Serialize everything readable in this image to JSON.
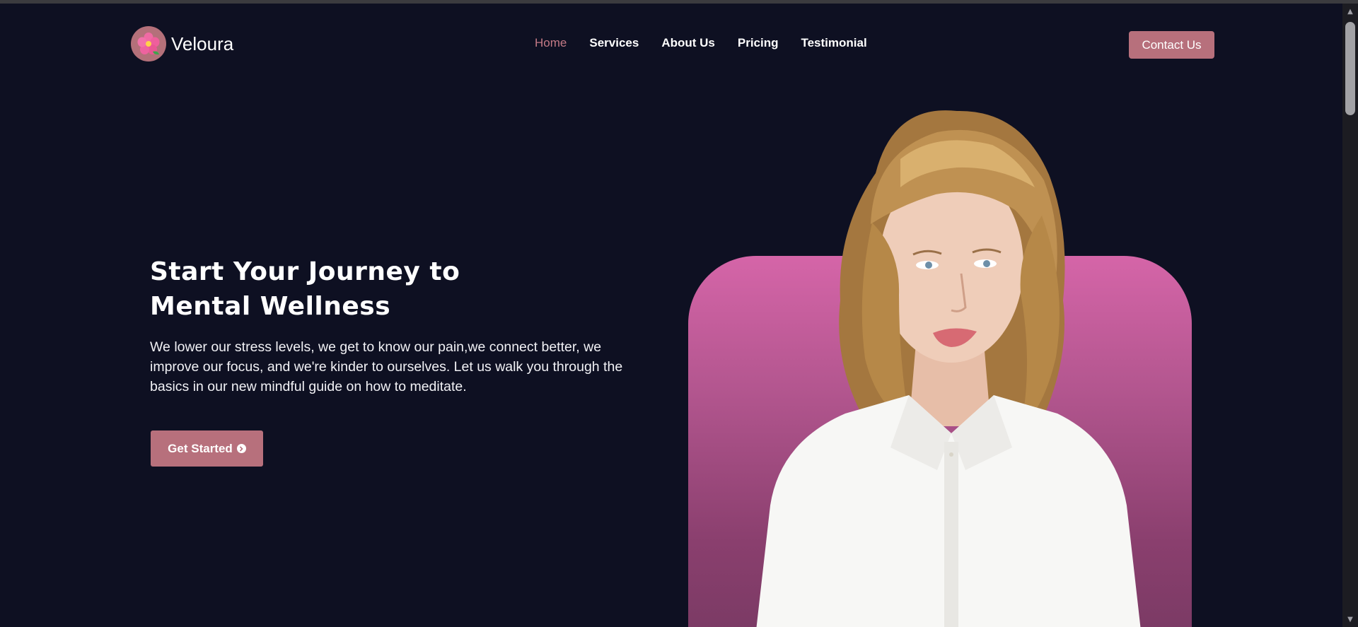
{
  "brand": {
    "name": "Veloura",
    "logo_icon": "hibiscus-flower-icon"
  },
  "nav": {
    "links": [
      {
        "label": "Home",
        "active": true
      },
      {
        "label": "Services",
        "active": false
      },
      {
        "label": "About Us",
        "active": false
      },
      {
        "label": "Pricing",
        "active": false
      },
      {
        "label": "Testimonial",
        "active": false
      }
    ],
    "contact_label": "Contact Us"
  },
  "hero": {
    "title_line1": "Start Your Journey to",
    "title_line2": "Mental Wellness",
    "description": "We lower our stress levels, we get to know our pain,we connect better, we improve our focus, and we're kinder to ourselves. Let us walk you through the basics in our new mindful guide on how to meditate.",
    "cta_label": "Get Started",
    "cta_icon": "arrow-circle-right-icon",
    "image_alt": "portrait of woman in white shirt"
  },
  "colors": {
    "background": "#0e1022",
    "accent": "#b7707c",
    "active_link": "#c47a86",
    "image_gradient_top": "#d565a8",
    "image_gradient_bottom": "#7a3a64"
  }
}
